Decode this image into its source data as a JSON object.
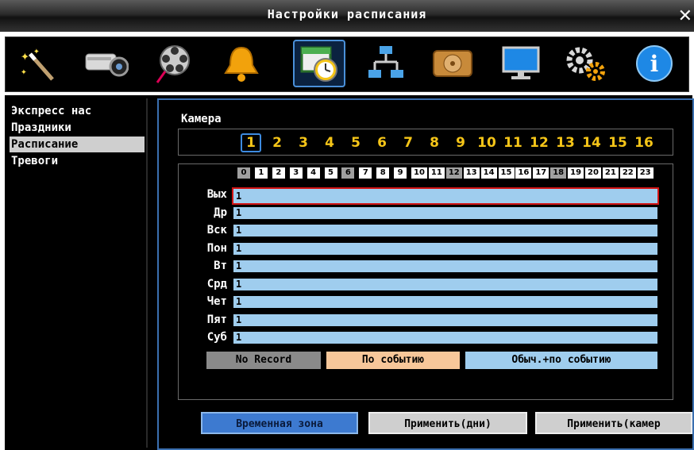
{
  "window": {
    "title": "Настройки расписания",
    "close_glyph": "✕"
  },
  "toolbar": {
    "icons": [
      "magic-wand-icon",
      "camera-icon",
      "film-reel-icon",
      "bell-icon",
      "schedule-clock-icon",
      "network-icon",
      "hdd-icon",
      "monitor-icon",
      "gears-icon",
      "info-icon"
    ],
    "selected": "schedule-clock-icon"
  },
  "sidebar": {
    "items": [
      "Экспресс нас",
      "Праздники",
      "Расписание",
      "Тревоги"
    ],
    "selected": "Расписание"
  },
  "camera": {
    "label": "Камера",
    "numbers": [
      "1",
      "2",
      "3",
      "4",
      "5",
      "6",
      "7",
      "8",
      "9",
      "10",
      "11",
      "12",
      "13",
      "14",
      "15",
      "16"
    ],
    "selected": "1"
  },
  "schedule": {
    "hours": [
      "0",
      "1",
      "2",
      "3",
      "4",
      "5",
      "6",
      "7",
      "8",
      "9",
      "10",
      "11",
      "12",
      "13",
      "14",
      "15",
      "16",
      "17",
      "18",
      "19",
      "20",
      "21",
      "22",
      "23"
    ],
    "dimmed_hours": [
      "0",
      "6",
      "12",
      "18"
    ],
    "days": [
      {
        "label": "Вых",
        "value": "1"
      },
      {
        "label": "Др",
        "value": "1"
      },
      {
        "label": "Вск",
        "value": "1"
      },
      {
        "label": "Пон",
        "value": "1"
      },
      {
        "label": "Вт",
        "value": "1"
      },
      {
        "label": "Срд",
        "value": "1"
      },
      {
        "label": "Чет",
        "value": "1"
      },
      {
        "label": "Пят",
        "value": "1"
      },
      {
        "label": "Суб",
        "value": "1"
      }
    ],
    "selected_day": "Вых"
  },
  "legend": {
    "no_record": "No Record",
    "on_event": "По событию",
    "normal_event": "Обыч.+по событию"
  },
  "buttons": {
    "timezone": "Временная зона",
    "apply_days": "Применить(дни)",
    "apply_cameras": "Применить(камер"
  },
  "colors": {
    "accent_blue": "#3d8be0",
    "bar_blue": "#9fcdee",
    "legend_gray": "#8a8a8a",
    "legend_peach": "#f7c79a",
    "legend_blue": "#9fcdee",
    "selection_red": "#d21414",
    "camera_numbers": "#f5c518"
  }
}
